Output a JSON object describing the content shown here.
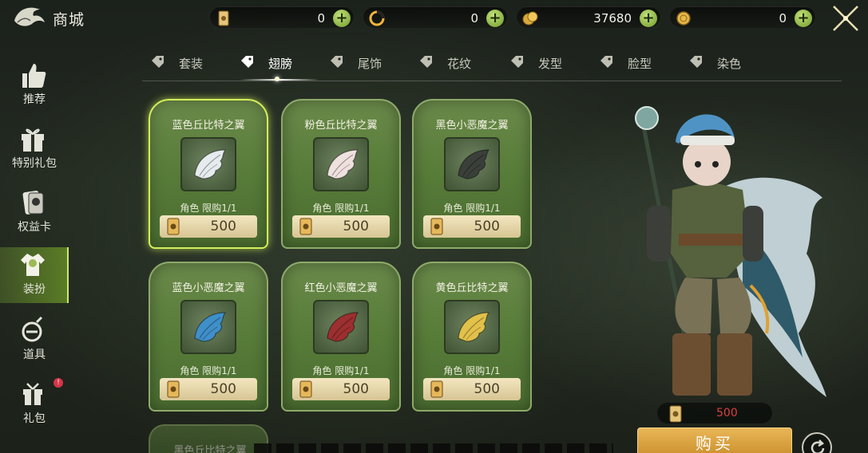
{
  "header": {
    "title": "商城",
    "currencies": [
      {
        "icon": "card-ticket-icon",
        "value": "0"
      },
      {
        "icon": "swirl-coin-icon",
        "value": "0"
      },
      {
        "icon": "gold-coin-stack-icon",
        "value": "37680"
      },
      {
        "icon": "gold-coin-icon",
        "value": "0"
      }
    ],
    "plus_label": "+"
  },
  "sidebar": {
    "items": [
      {
        "label": "推荐",
        "icon": "thumbs-up-icon",
        "active": false
      },
      {
        "label": "特别礼包",
        "icon": "gift-box-icon",
        "active": false
      },
      {
        "label": "权益卡",
        "icon": "privilege-card-icon",
        "active": false
      },
      {
        "label": "装扮",
        "icon": "outfit-icon",
        "active": true
      },
      {
        "label": "道具",
        "icon": "potion-icon",
        "active": false
      },
      {
        "label": "礼包",
        "icon": "gift-icon",
        "active": false
      }
    ],
    "badge": "!"
  },
  "tabs": [
    {
      "label": "套装",
      "active": false
    },
    {
      "label": "翅膀",
      "active": true
    },
    {
      "label": "尾饰",
      "active": false
    },
    {
      "label": "花纹",
      "active": false
    },
    {
      "label": "发型",
      "active": false
    },
    {
      "label": "脸型",
      "active": false
    },
    {
      "label": "染色",
      "active": false
    }
  ],
  "products": [
    {
      "name": "蓝色丘比特之翼",
      "limit": "角色 限购1/1",
      "price": "500",
      "wing_color": "#e6ebee",
      "selected": true
    },
    {
      "name": "粉色丘比特之翼",
      "limit": "角色 限购1/1",
      "price": "500",
      "wing_color": "#efe1de",
      "selected": false
    },
    {
      "name": "黑色小恶魔之翼",
      "limit": "角色 限购1/1",
      "price": "500",
      "wing_color": "#3b3f3a",
      "selected": false
    },
    {
      "name": "蓝色小恶魔之翼",
      "limit": "角色 限购1/1",
      "price": "500",
      "wing_color": "#3f8fc9",
      "selected": false
    },
    {
      "name": "红色小恶魔之翼",
      "limit": "角色 限购1/1",
      "price": "500",
      "wing_color": "#9c2f2f",
      "selected": false
    },
    {
      "name": "黄色丘比特之翼",
      "limit": "角色 限购1/1",
      "price": "500",
      "wing_color": "#e1c14a",
      "selected": false
    }
  ],
  "partial_product": {
    "name": "黑色丘比特之翼"
  },
  "preview": {
    "price": "500",
    "buy_label": "购买",
    "refresh_icon": "refresh-icon"
  },
  "colors": {
    "accent_green": "#cfe872",
    "buy_orange": "#e0a240",
    "price_red": "#d94040"
  }
}
